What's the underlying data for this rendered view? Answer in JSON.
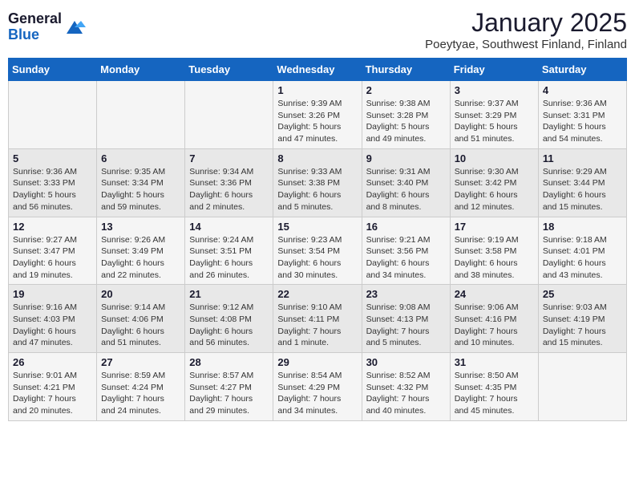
{
  "header": {
    "logo_general": "General",
    "logo_blue": "Blue",
    "month_title": "January 2025",
    "location": "Poeytyae, Southwest Finland, Finland"
  },
  "weekdays": [
    "Sunday",
    "Monday",
    "Tuesday",
    "Wednesday",
    "Thursday",
    "Friday",
    "Saturday"
  ],
  "weeks": [
    [
      {
        "day": "",
        "info": ""
      },
      {
        "day": "",
        "info": ""
      },
      {
        "day": "",
        "info": ""
      },
      {
        "day": "1",
        "info": "Sunrise: 9:39 AM\nSunset: 3:26 PM\nDaylight: 5 hours\nand 47 minutes."
      },
      {
        "day": "2",
        "info": "Sunrise: 9:38 AM\nSunset: 3:28 PM\nDaylight: 5 hours\nand 49 minutes."
      },
      {
        "day": "3",
        "info": "Sunrise: 9:37 AM\nSunset: 3:29 PM\nDaylight: 5 hours\nand 51 minutes."
      },
      {
        "day": "4",
        "info": "Sunrise: 9:36 AM\nSunset: 3:31 PM\nDaylight: 5 hours\nand 54 minutes."
      }
    ],
    [
      {
        "day": "5",
        "info": "Sunrise: 9:36 AM\nSunset: 3:33 PM\nDaylight: 5 hours\nand 56 minutes."
      },
      {
        "day": "6",
        "info": "Sunrise: 9:35 AM\nSunset: 3:34 PM\nDaylight: 5 hours\nand 59 minutes."
      },
      {
        "day": "7",
        "info": "Sunrise: 9:34 AM\nSunset: 3:36 PM\nDaylight: 6 hours\nand 2 minutes."
      },
      {
        "day": "8",
        "info": "Sunrise: 9:33 AM\nSunset: 3:38 PM\nDaylight: 6 hours\nand 5 minutes."
      },
      {
        "day": "9",
        "info": "Sunrise: 9:31 AM\nSunset: 3:40 PM\nDaylight: 6 hours\nand 8 minutes."
      },
      {
        "day": "10",
        "info": "Sunrise: 9:30 AM\nSunset: 3:42 PM\nDaylight: 6 hours\nand 12 minutes."
      },
      {
        "day": "11",
        "info": "Sunrise: 9:29 AM\nSunset: 3:44 PM\nDaylight: 6 hours\nand 15 minutes."
      }
    ],
    [
      {
        "day": "12",
        "info": "Sunrise: 9:27 AM\nSunset: 3:47 PM\nDaylight: 6 hours\nand 19 minutes."
      },
      {
        "day": "13",
        "info": "Sunrise: 9:26 AM\nSunset: 3:49 PM\nDaylight: 6 hours\nand 22 minutes."
      },
      {
        "day": "14",
        "info": "Sunrise: 9:24 AM\nSunset: 3:51 PM\nDaylight: 6 hours\nand 26 minutes."
      },
      {
        "day": "15",
        "info": "Sunrise: 9:23 AM\nSunset: 3:54 PM\nDaylight: 6 hours\nand 30 minutes."
      },
      {
        "day": "16",
        "info": "Sunrise: 9:21 AM\nSunset: 3:56 PM\nDaylight: 6 hours\nand 34 minutes."
      },
      {
        "day": "17",
        "info": "Sunrise: 9:19 AM\nSunset: 3:58 PM\nDaylight: 6 hours\nand 38 minutes."
      },
      {
        "day": "18",
        "info": "Sunrise: 9:18 AM\nSunset: 4:01 PM\nDaylight: 6 hours\nand 43 minutes."
      }
    ],
    [
      {
        "day": "19",
        "info": "Sunrise: 9:16 AM\nSunset: 4:03 PM\nDaylight: 6 hours\nand 47 minutes."
      },
      {
        "day": "20",
        "info": "Sunrise: 9:14 AM\nSunset: 4:06 PM\nDaylight: 6 hours\nand 51 minutes."
      },
      {
        "day": "21",
        "info": "Sunrise: 9:12 AM\nSunset: 4:08 PM\nDaylight: 6 hours\nand 56 minutes."
      },
      {
        "day": "22",
        "info": "Sunrise: 9:10 AM\nSunset: 4:11 PM\nDaylight: 7 hours\nand 1 minute."
      },
      {
        "day": "23",
        "info": "Sunrise: 9:08 AM\nSunset: 4:13 PM\nDaylight: 7 hours\nand 5 minutes."
      },
      {
        "day": "24",
        "info": "Sunrise: 9:06 AM\nSunset: 4:16 PM\nDaylight: 7 hours\nand 10 minutes."
      },
      {
        "day": "25",
        "info": "Sunrise: 9:03 AM\nSunset: 4:19 PM\nDaylight: 7 hours\nand 15 minutes."
      }
    ],
    [
      {
        "day": "26",
        "info": "Sunrise: 9:01 AM\nSunset: 4:21 PM\nDaylight: 7 hours\nand 20 minutes."
      },
      {
        "day": "27",
        "info": "Sunrise: 8:59 AM\nSunset: 4:24 PM\nDaylight: 7 hours\nand 24 minutes."
      },
      {
        "day": "28",
        "info": "Sunrise: 8:57 AM\nSunset: 4:27 PM\nDaylight: 7 hours\nand 29 minutes."
      },
      {
        "day": "29",
        "info": "Sunrise: 8:54 AM\nSunset: 4:29 PM\nDaylight: 7 hours\nand 34 minutes."
      },
      {
        "day": "30",
        "info": "Sunrise: 8:52 AM\nSunset: 4:32 PM\nDaylight: 7 hours\nand 40 minutes."
      },
      {
        "day": "31",
        "info": "Sunrise: 8:50 AM\nSunset: 4:35 PM\nDaylight: 7 hours\nand 45 minutes."
      },
      {
        "day": "",
        "info": ""
      }
    ]
  ]
}
